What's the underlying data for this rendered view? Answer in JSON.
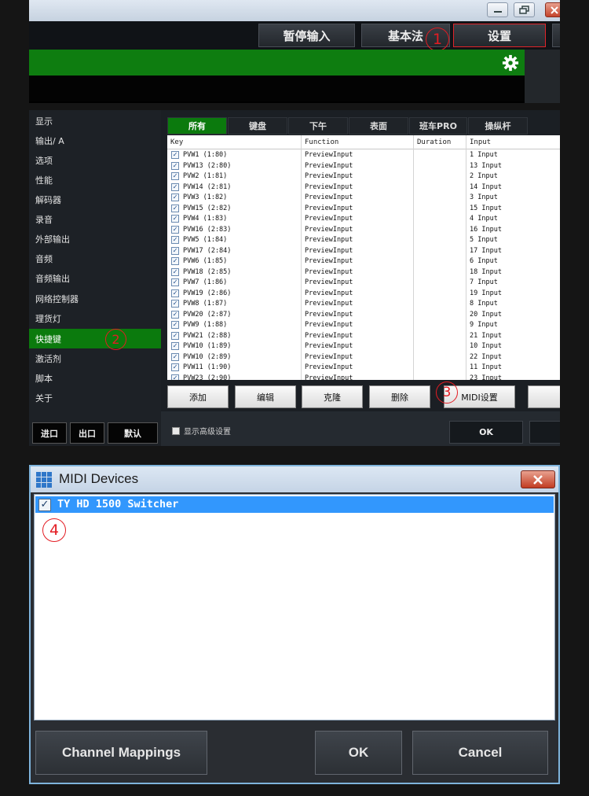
{
  "panel1": {
    "toolbar": {
      "pause_label": "暂停输入",
      "basic_label": "基本法",
      "settings_label": "设置"
    },
    "annotation": "1"
  },
  "panel2": {
    "sidebar": {
      "items": [
        "显示",
        "输出/ A",
        "选项",
        "性能",
        "解码器",
        "录音",
        "外部输出",
        "音频",
        "音频输出",
        "网络控制器",
        "理货灯",
        "快捷键",
        "激活剂",
        "脚本",
        "关于"
      ],
      "active_index": 11,
      "buttons": {
        "import": "进口",
        "export": "出口",
        "default": "默认"
      }
    },
    "annotation_sidebar": "2",
    "tabs": [
      "所有",
      "键盘",
      "下午",
      "表面",
      "班车PRO",
      "操纵杆"
    ],
    "active_tab_index": 0,
    "grid": {
      "columns": [
        "Key",
        "Function",
        "Duration",
        "Input"
      ],
      "rows": [
        {
          "key": "PVW1 (1:80)",
          "function": "PreviewInput",
          "duration": "",
          "input": "1 Input"
        },
        {
          "key": "PVW13 (2:80)",
          "function": "PreviewInput",
          "duration": "",
          "input": "13 Input"
        },
        {
          "key": "PVW2 (1:81)",
          "function": "PreviewInput",
          "duration": "",
          "input": "2 Input"
        },
        {
          "key": "PVW14 (2:81)",
          "function": "PreviewInput",
          "duration": "",
          "input": "14 Input"
        },
        {
          "key": "PVW3 (1:82)",
          "function": "PreviewInput",
          "duration": "",
          "input": "3 Input"
        },
        {
          "key": "PVW15 (2:82)",
          "function": "PreviewInput",
          "duration": "",
          "input": "15 Input"
        },
        {
          "key": "PVW4 (1:83)",
          "function": "PreviewInput",
          "duration": "",
          "input": "4 Input"
        },
        {
          "key": "PVW16 (2:83)",
          "function": "PreviewInput",
          "duration": "",
          "input": "16 Input"
        },
        {
          "key": "PVW5 (1:84)",
          "function": "PreviewInput",
          "duration": "",
          "input": "5 Input"
        },
        {
          "key": "PVW17 (2:84)",
          "function": "PreviewInput",
          "duration": "",
          "input": "17 Input"
        },
        {
          "key": "PVW6 (1:85)",
          "function": "PreviewInput",
          "duration": "",
          "input": "6 Input"
        },
        {
          "key": "PVW18 (2:85)",
          "function": "PreviewInput",
          "duration": "",
          "input": "18 Input"
        },
        {
          "key": "PVW7 (1:86)",
          "function": "PreviewInput",
          "duration": "",
          "input": "7 Input"
        },
        {
          "key": "PVW19 (2:86)",
          "function": "PreviewInput",
          "duration": "",
          "input": "19 Input"
        },
        {
          "key": "PVW8 (1:87)",
          "function": "PreviewInput",
          "duration": "",
          "input": "8 Input"
        },
        {
          "key": "PVW20 (2:87)",
          "function": "PreviewInput",
          "duration": "",
          "input": "20 Input"
        },
        {
          "key": "PVW9 (1:88)",
          "function": "PreviewInput",
          "duration": "",
          "input": "9 Input"
        },
        {
          "key": "PVW21 (2:88)",
          "function": "PreviewInput",
          "duration": "",
          "input": "21 Input"
        },
        {
          "key": "PVW10 (1:89)",
          "function": "PreviewInput",
          "duration": "",
          "input": "10 Input"
        },
        {
          "key": "PVW10 (2:89)",
          "function": "PreviewInput",
          "duration": "",
          "input": "22 Input"
        },
        {
          "key": "PVW11 (1:90)",
          "function": "PreviewInput",
          "duration": "",
          "input": "11 Input"
        },
        {
          "key": "PVW23 (2:90)",
          "function": "PreviewInput",
          "duration": "",
          "input": "23 Input"
        }
      ]
    },
    "actions": {
      "add": "添加",
      "edit": "编辑",
      "clone": "克隆",
      "delete": "删除",
      "midi": "MIDI设置"
    },
    "annotation_midi": "3",
    "advanced_label": "显示高级设置",
    "ok_label": "OK"
  },
  "panel3": {
    "title": "MIDI Devices",
    "device": "TY HD 1500 Switcher",
    "device_checked": true,
    "annotation": "4",
    "buttons": {
      "channel": "Channel Mappings",
      "ok": "OK",
      "cancel": "Cancel"
    }
  },
  "colors": {
    "accent_green": "#0b7a0d",
    "annotation_red": "#e31c23",
    "selection_blue": "#3297fd"
  }
}
